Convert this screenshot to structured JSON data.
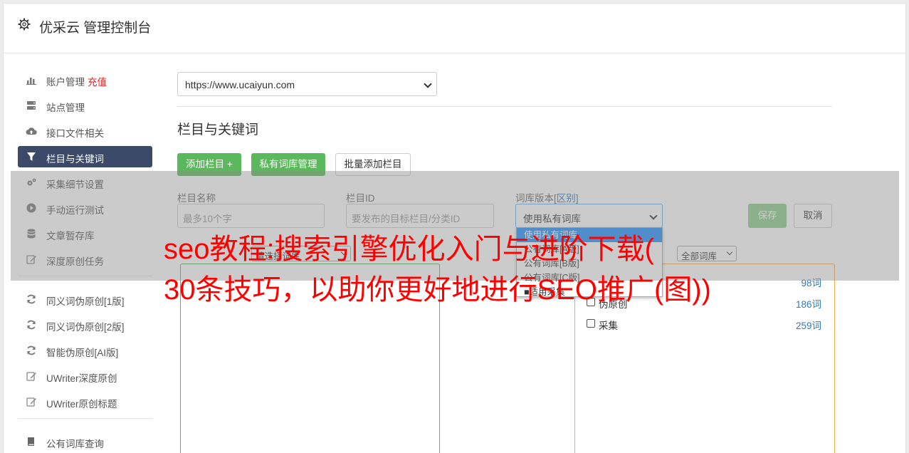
{
  "header": {
    "title": "优采云 管理控制台"
  },
  "sidebar": {
    "group1": [
      {
        "label": "账户管理",
        "extra": "充值",
        "icon": "bar-chart-icon"
      },
      {
        "label": "站点管理",
        "icon": "server-icon"
      },
      {
        "label": "接口文件相关",
        "icon": "cloud-upload-icon"
      },
      {
        "label": "栏目与关键词",
        "icon": "filter-icon",
        "active": true
      },
      {
        "label": "采集细节设置",
        "icon": "cogs-icon"
      },
      {
        "label": "手动运行测试",
        "icon": "play-circle-icon"
      },
      {
        "label": "文章暂存库",
        "icon": "database-icon"
      },
      {
        "label": "深度原创任务",
        "icon": "edit-icon"
      }
    ],
    "group2": [
      {
        "label": "同义词伪原创[1版]",
        "icon": "refresh-icon"
      },
      {
        "label": "同义词伪原创[2版]",
        "icon": "refresh-icon"
      },
      {
        "label": "智能伪原创[AI版]",
        "icon": "refresh-icon"
      },
      {
        "label": "UWriter深度原创",
        "icon": "edit-icon"
      },
      {
        "label": "UWriter原创标题",
        "icon": "edit-icon"
      }
    ],
    "group3": [
      {
        "label": "公有词库查询",
        "icon": "book-icon"
      }
    ]
  },
  "main": {
    "site_select": {
      "value": "https://www.ucaiyun.com"
    },
    "section_title": "栏目与关键词",
    "buttons": {
      "add_column": "添加栏目 +",
      "private_lib": "私有词库管理",
      "batch_add": "批量添加栏目",
      "save": "保存",
      "cancel": "取消"
    },
    "form": {
      "name_label": "栏目名称",
      "name_placeholder": "最多10个字",
      "id_label": "栏目ID",
      "id_placeholder": "要发布的目标栏目/分类ID",
      "lib_label": "词库版本",
      "lib_label_link": "[区别]",
      "lib_value": "使用私有词库",
      "lib_options": [
        "使用私有词库",
        "公有词库[A版]",
        "公有词库[B版]",
        "公有词库[C版]",
        "■适用采集"
      ],
      "keyword_select": "请选择词库",
      "type_select": "全部词库"
    },
    "libraries": [
      {
        "name": "",
        "count": "98词"
      },
      {
        "name": "伪原创",
        "count": "186词"
      },
      {
        "name": "采集",
        "count": "259词"
      }
    ]
  },
  "watermark": {
    "line1": "seo教程:搜索引擎优化入门与进阶下载(",
    "line2": "30条技巧，以助你更好地进行SEO推广(图))",
    "color": "#ff0000"
  },
  "colors": {
    "accent_green": "#5cb85c",
    "nav_active": "#3a4a68",
    "link_blue": "#337ab7",
    "charge_red": "#e02020"
  }
}
